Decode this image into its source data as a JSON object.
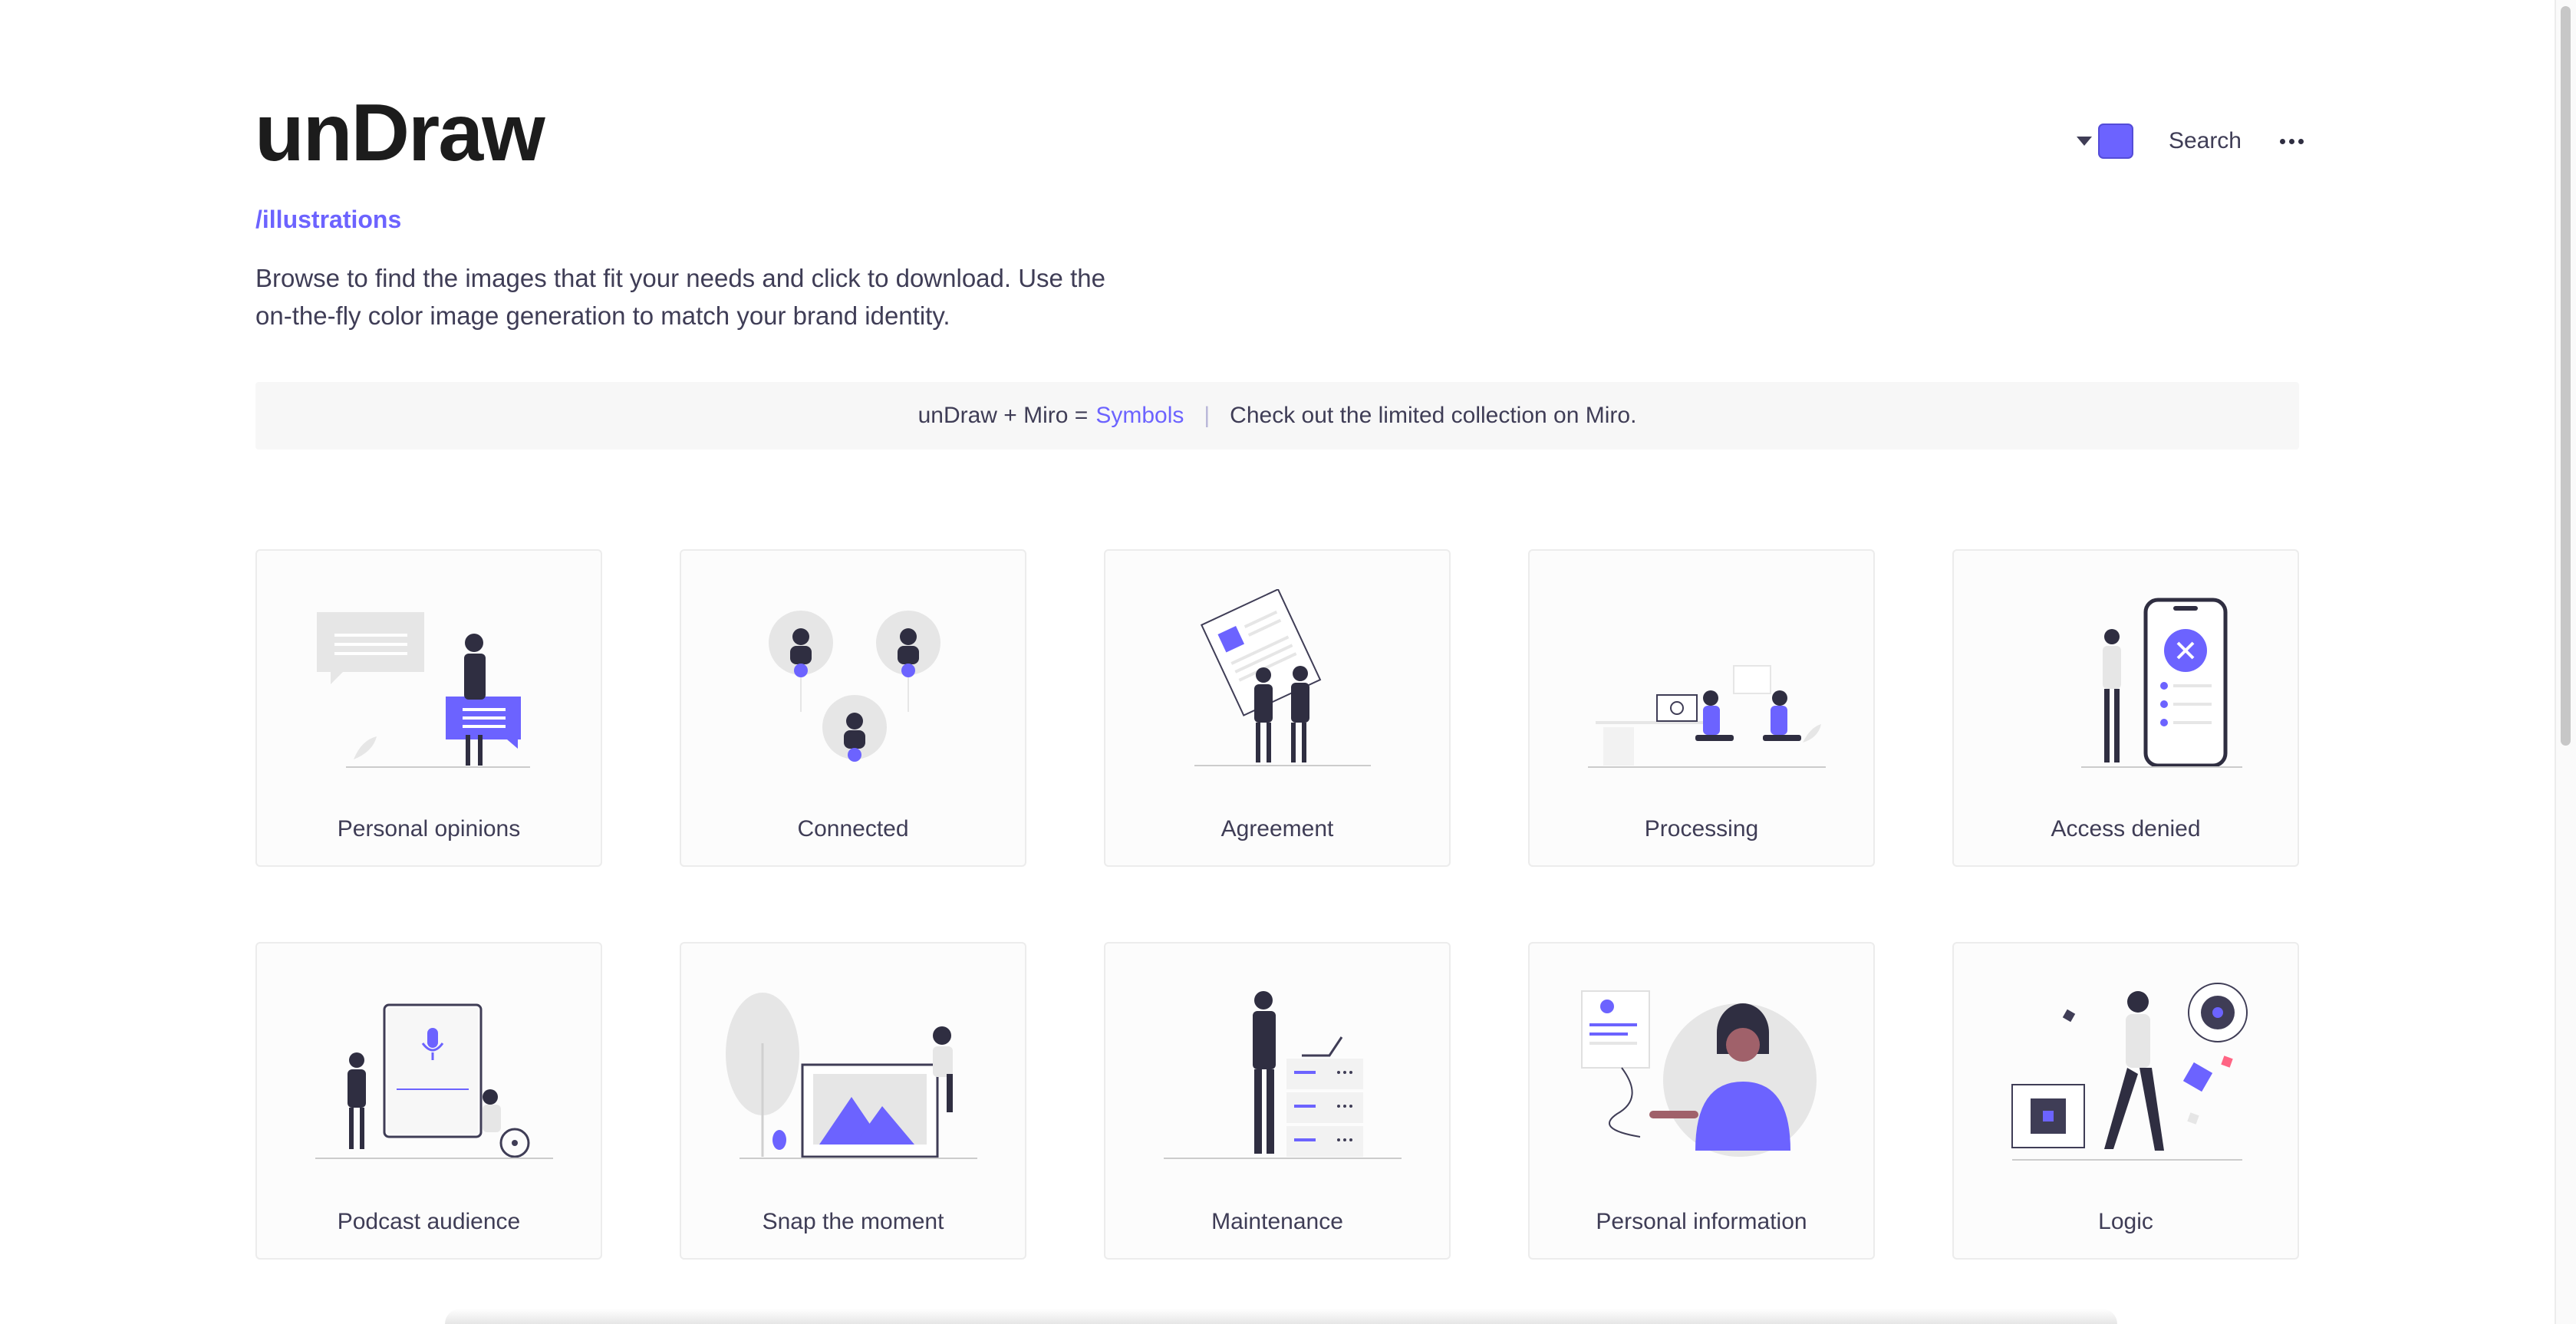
{
  "header": {
    "logo": "unDraw",
    "breadcrumb": "/illustrations",
    "intro": "Browse to find the images that fit your needs and click to download. Use the on-the-fly color image generation to match your brand identity.",
    "search_label": "Search",
    "accent_color": "#6c63ff",
    "icons": [
      "caret-down-icon",
      "color-swatch",
      "more-horizontal-icon"
    ]
  },
  "banner": {
    "prefix": "unDraw + Miro =",
    "link": "Symbols",
    "separator": "|",
    "text": "Check out the limited collection on Miro."
  },
  "illustrations": [
    {
      "title": "Personal opinions",
      "icon": "personal-opinions-illustration"
    },
    {
      "title": "Connected",
      "icon": "connected-illustration"
    },
    {
      "title": "Agreement",
      "icon": "agreement-illustration"
    },
    {
      "title": "Processing",
      "icon": "processing-illustration"
    },
    {
      "title": "Access denied",
      "icon": "access-denied-illustration"
    },
    {
      "title": "Podcast audience",
      "icon": "podcast-audience-illustration"
    },
    {
      "title": "Snap the moment",
      "icon": "snap-the-moment-illustration"
    },
    {
      "title": "Maintenance",
      "icon": "maintenance-illustration"
    },
    {
      "title": "Personal information",
      "icon": "personal-information-illustration"
    },
    {
      "title": "Logic",
      "icon": "logic-illustration"
    }
  ]
}
